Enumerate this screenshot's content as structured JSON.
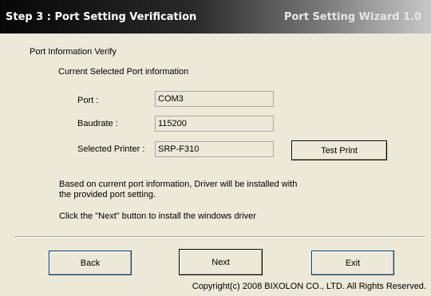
{
  "header": {
    "step_title": "Step 3 : Port Setting Verification",
    "wizard_name": "Port Setting Wizard 1.0"
  },
  "section": {
    "title": "Port Information Verify",
    "subtitle": "Current Selected Port information"
  },
  "fields": {
    "port_label": "Port :",
    "port_value": "COM3",
    "baudrate_label": "Baudrate :",
    "baudrate_value": "115200",
    "printer_label": "Selected Printer :",
    "printer_value": "SRP-F310"
  },
  "messages": {
    "line1": "Based on current port information, Driver will be installed with",
    "line2": "the provided port setting.",
    "line3": "Click the \"Next\" button to install the windows driver"
  },
  "buttons": {
    "test_print": "Test Print",
    "back": "Back",
    "next": "Next",
    "exit": "Exit"
  },
  "footer": {
    "copyright": "Copyright(c) 2008 BIXOLON CO., LTD. All Rights Reserved."
  },
  "colors": {
    "window_bg": "#ece9d8",
    "header_dark": "#070707",
    "header_light": "#c8c8c8"
  }
}
